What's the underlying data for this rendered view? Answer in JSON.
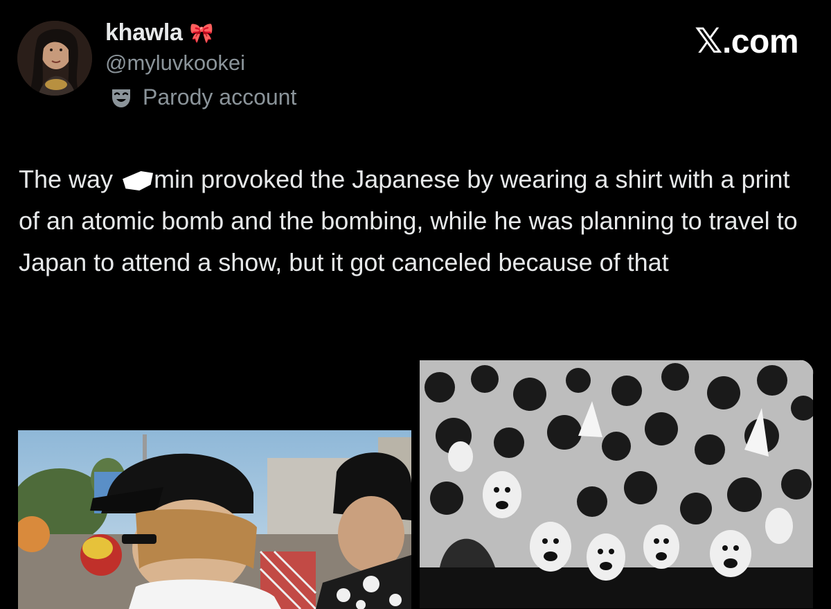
{
  "post": {
    "display_name": "khawla",
    "name_emoji": "🎀",
    "handle": "@myluvkookei",
    "badge_label": "Parody account",
    "badge_icon": "theater-masks-icon",
    "text_before_redaction": "The way ",
    "text_after_redaction": "min  provoked the Japanese by wearing a shirt with a print of an atomic bomb and the bombing, while he was planning to travel to Japan to attend a show, but it got canceled because of that"
  },
  "brand": {
    "mark": "𝕏",
    "domain": ".com"
  },
  "media": [
    {
      "kind": "photo",
      "icon": "photo-crowd-street"
    },
    {
      "kind": "photo",
      "icon": "photo-crowd-black-and-white"
    }
  ],
  "colors": {
    "background": "#000000",
    "primary_text": "#e7e9ea",
    "secondary_text": "#8b949a"
  }
}
